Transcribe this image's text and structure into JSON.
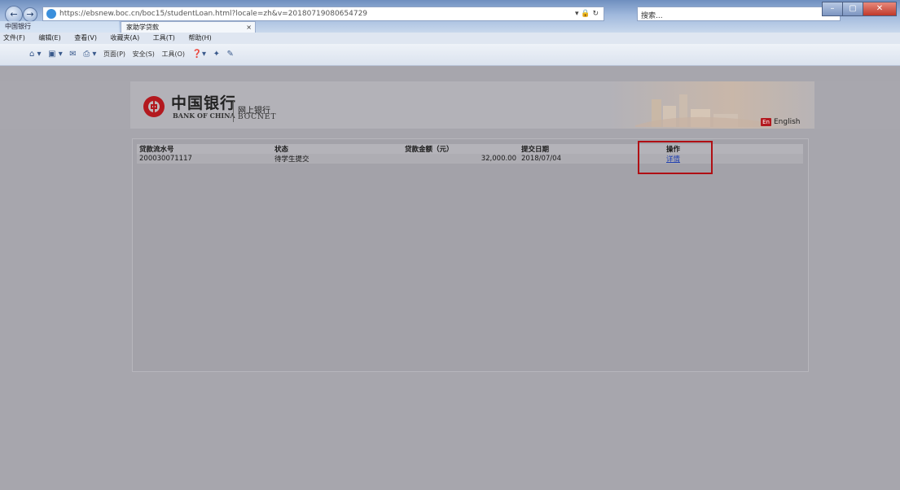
{
  "browser": {
    "url": "https://ebsnew.boc.cn/boc15/studentLoan.html?locale=zh&v=20180719080654729",
    "url_host_bold": "boc.cn",
    "search_placeholder": "搜索...",
    "tabs": [
      {
        "label": "中国银行"
      },
      {
        "label": "家助学贷款"
      }
    ],
    "tab_close": "×",
    "menu": [
      "文件(F)",
      "编辑(E)",
      "查看(V)",
      "收藏夹(A)",
      "工具(T)",
      "帮助(H)"
    ],
    "commands": [
      "页面(P)",
      "安全(S)",
      "工具(O)"
    ],
    "window_buttons": {
      "minimize": "–",
      "maximize": "▢",
      "close": "✕"
    }
  },
  "header": {
    "bank_name_cn": "中国银行",
    "bank_name_en": "BANK OF CHINA",
    "product_cn": "网上银行",
    "product_en": "BOCNET",
    "lang_icon": "En",
    "lang_label": "English"
  },
  "loans_table": {
    "columns": [
      "贷款流水号",
      "状态",
      "贷款金额（元）",
      "提交日期",
      "操作"
    ],
    "rows": [
      {
        "serial": "200030071117",
        "status": "待学生提交",
        "amount": "32,000.00",
        "date": "2018/07/04",
        "action": "详情"
      }
    ]
  },
  "colors": {
    "brand_red": "#b3191f",
    "highlight": "#b00f14",
    "link": "#1f3fb0"
  }
}
